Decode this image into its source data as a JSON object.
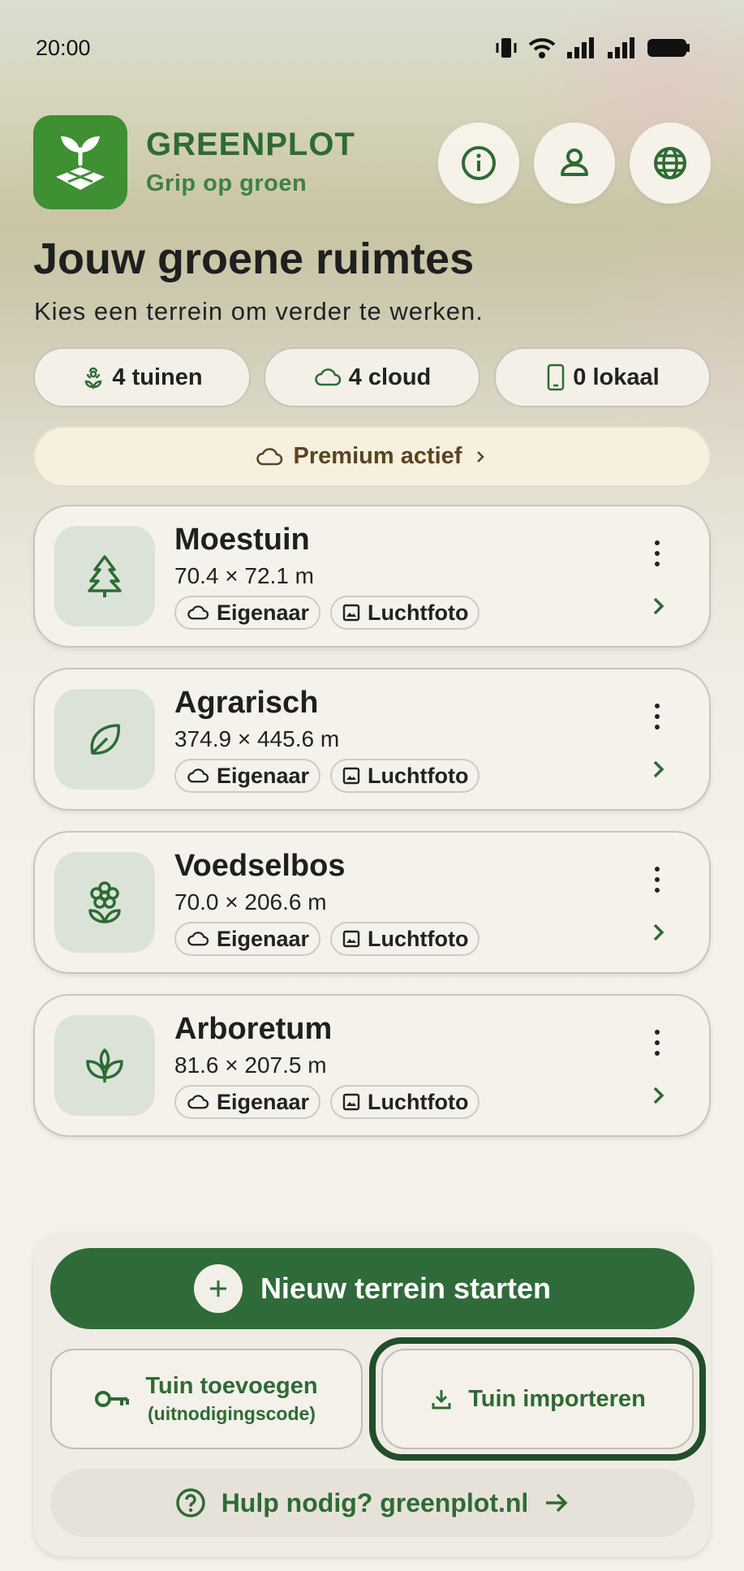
{
  "status_bar": {
    "time": "20:00"
  },
  "header": {
    "app_name": "GREENPLOT",
    "tagline": "Grip op groen"
  },
  "page": {
    "title": "Jouw groene ruimtes",
    "subtitle": "Kies een terrein om verder te werken."
  },
  "stats": [
    {
      "label": "4 tuinen",
      "icon": "flower-icon"
    },
    {
      "label": "4 cloud",
      "icon": "cloud-icon"
    },
    {
      "label": "0 lokaal",
      "icon": "phone-icon"
    }
  ],
  "premium": {
    "label": "Premium actief"
  },
  "gardens": [
    {
      "name": "Moestuin",
      "size": "70.4 × 72.1 m",
      "icon": "tree-icon",
      "role": "Eigenaar",
      "layer": "Luchtfoto"
    },
    {
      "name": "Agrarisch",
      "size": "374.9 × 445.6 m",
      "icon": "leaf-icon",
      "role": "Eigenaar",
      "layer": "Luchtfoto"
    },
    {
      "name": "Voedselbos",
      "size": "70.0 × 206.6 m",
      "icon": "flower-icon",
      "role": "Eigenaar",
      "layer": "Luchtfoto"
    },
    {
      "name": "Arboretum",
      "size": "81.6 × 207.5 m",
      "icon": "sprout-icon",
      "role": "Eigenaar",
      "layer": "Luchtfoto"
    }
  ],
  "actions": {
    "new_terrain": "Nieuw terrein starten",
    "add_garden": "Tuin toevoegen",
    "add_garden_hint": "(uitnodigingscode)",
    "import_garden": "Tuin importeren",
    "help": "Hulp nodig? greenplot.nl"
  },
  "colors": {
    "brand_green": "#2f6b39",
    "logo_green": "#3f8f33",
    "premium_bg": "#f6f0de",
    "thumb_bg": "#dbe3d8"
  }
}
